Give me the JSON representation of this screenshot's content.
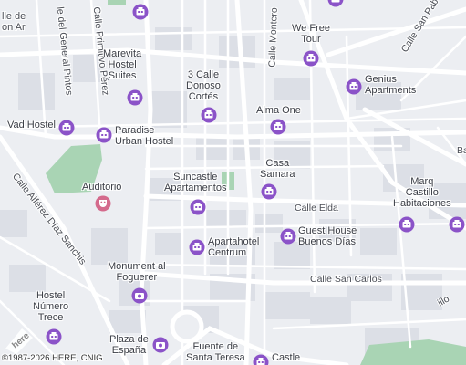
{
  "colors": {
    "hotel_pin": "#8b53c8",
    "auditorium_pin": "#d46a8c",
    "park": "#a9d4b4",
    "background": "#eceef2",
    "road": "#ffffff",
    "block": "#dcdfe6"
  },
  "places": [
    {
      "name": "Marevita\nHostel\nSuites",
      "icon": "hotel-icon"
    },
    {
      "name": "3 Calle\nDonoso\nCortés",
      "icon": "hotel-icon"
    },
    {
      "name": "We Free\nTour",
      "icon": "hotel-icon"
    },
    {
      "name": "Genius\nApartments",
      "icon": "hotel-icon"
    },
    {
      "name": "Vad Hostel",
      "icon": "hotel-icon"
    },
    {
      "name": "Paradise\nUrban Hostel",
      "icon": "hotel-icon"
    },
    {
      "name": "Alma One",
      "icon": "hotel-icon"
    },
    {
      "name": "Casa\nSamara",
      "icon": "hotel-icon"
    },
    {
      "name": "Suncastle\nApartamentos",
      "icon": "hotel-icon"
    },
    {
      "name": "Auditorio",
      "icon": "auditorium-icon"
    },
    {
      "name": "Marq\nCastillo\nHabitaciones",
      "icon": "hotel-icon"
    },
    {
      "name": "Guest House\nBuenos Días",
      "icon": "hotel-icon"
    },
    {
      "name": "Apartahotel\nCentrum",
      "icon": "hotel-icon"
    },
    {
      "name": "Monument al\nFoguerer",
      "icon": "camera-icon"
    },
    {
      "name": "Hostel\nNúmero\nTrece",
      "icon": "hotel-icon"
    },
    {
      "name": "Plaza de\nEspaña",
      "icon": "camera-icon"
    },
    {
      "name": "Fuente de\nSanta Teresa",
      "icon": "camera-icon"
    },
    {
      "name": "Castle",
      "icon": "hotel-icon"
    }
  ],
  "streets": [
    "lle de\non Ar",
    "le del General Pintos",
    "Calle Primitivo Pérez",
    "Calle Montero",
    "Calle San Pab",
    "Calle Alférez Díaz Sanchis",
    "Calle Elda",
    "Calle San Carlos",
    "illo"
  ],
  "partial_labels": [
    "Ba"
  ],
  "copyright": "©1987-2026 HERE, CNIG",
  "logo_text": "here"
}
